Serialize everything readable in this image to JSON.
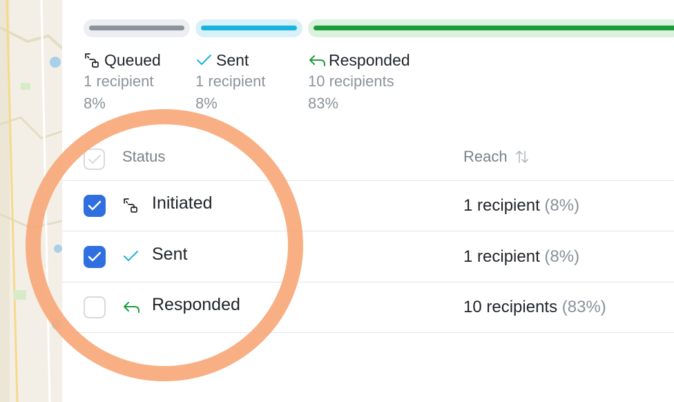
{
  "legend": [
    {
      "label": "Queued",
      "count": "1 recipient",
      "pct": "8%",
      "icon": "queued-icon"
    },
    {
      "label": "Sent",
      "count": "1 recipient",
      "pct": "8%",
      "icon": "check-icon"
    },
    {
      "label": "Responded",
      "count": "10 recipients",
      "pct": "83%",
      "icon": "reply-icon"
    }
  ],
  "progress": {
    "queued": 0.08,
    "sent": 0.08,
    "responded": 0.83
  },
  "table": {
    "headers": {
      "status": "Status",
      "reach": "Reach"
    },
    "rows": [
      {
        "status": "Initiated",
        "checked": true,
        "reach": "1 recipient",
        "pct": "(8%)",
        "icon": "queued-icon"
      },
      {
        "status": "Sent",
        "checked": true,
        "reach": "1 recipient",
        "pct": "(8%)",
        "icon": "check-icon"
      },
      {
        "status": "Responded",
        "checked": false,
        "reach": "10 recipients",
        "pct": "(83%)",
        "icon": "reply-icon"
      }
    ]
  },
  "colors": {
    "queued": "#8c939c",
    "sent": "#1bb3de",
    "responded": "#1d9c3a",
    "checkbox_checked": "#2f6fe0",
    "annotation": "#f7a677"
  }
}
